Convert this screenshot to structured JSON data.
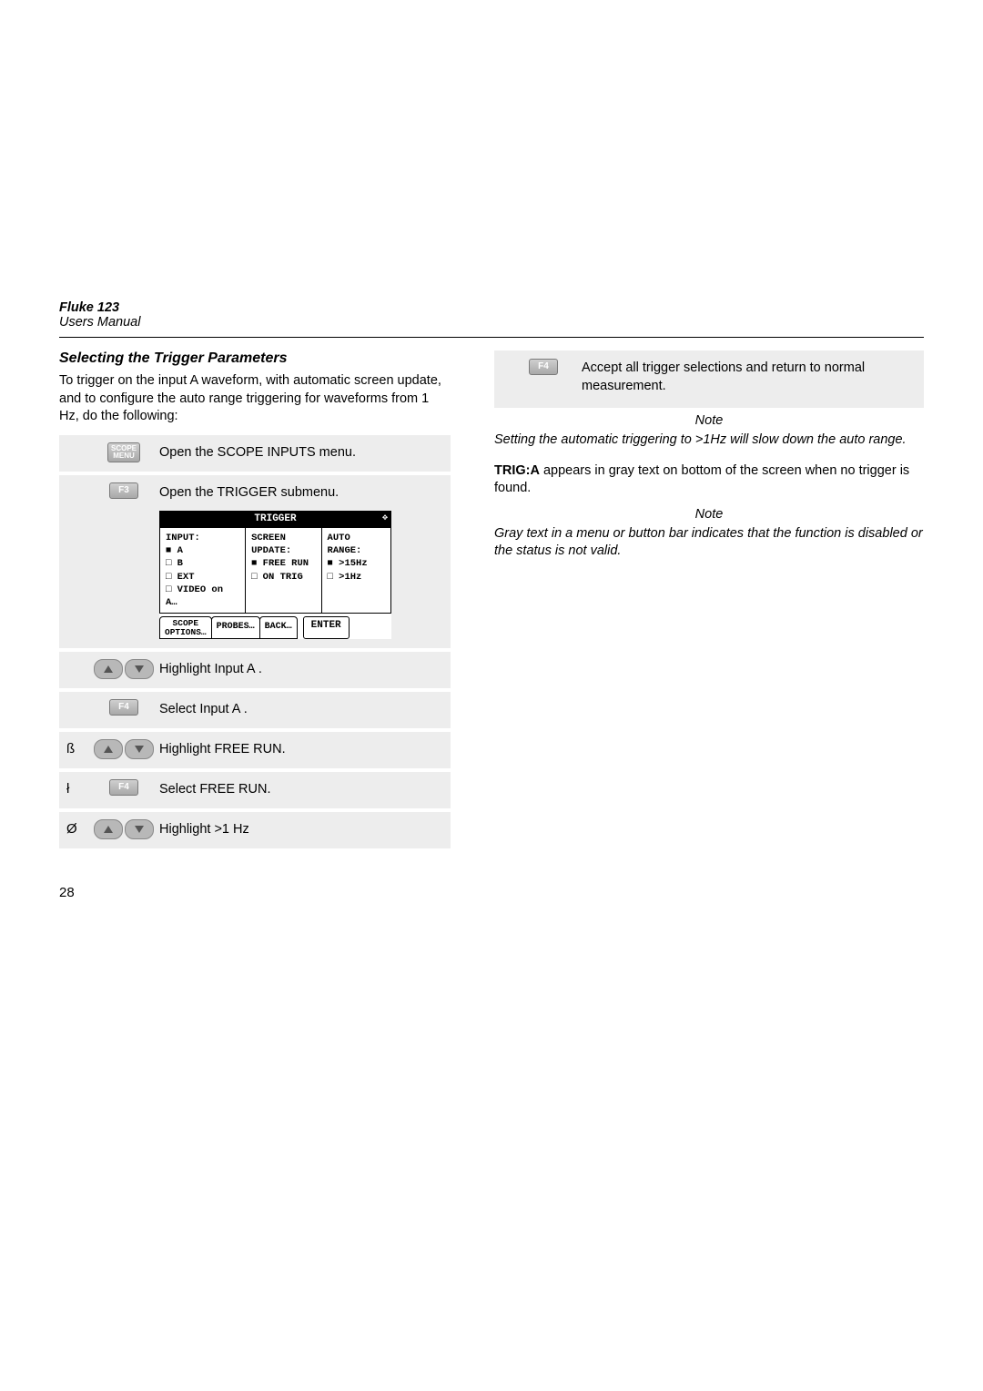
{
  "header": {
    "product": "Fluke 123",
    "manual": "Users Manual"
  },
  "pageNumber": "28",
  "left": {
    "sectionTitle": "Selecting the Trigger Parameters",
    "intro": "To trigger on the input A waveform, with automatic screen update, and to configure the auto range triggering for waveforms from 1 Hz, do the following:",
    "steps": [
      {
        "num": "",
        "keyType": "scope-menu",
        "keyLabelTop": "SCOPE",
        "keyLabelBot": "MENU",
        "text": "Open the SCOPE INPUTS menu."
      },
      {
        "num": "",
        "keyType": "f-key",
        "keyLabel": "F3",
        "text": "Open the TRIGGER submenu."
      },
      {
        "num": "",
        "keyType": "arrows",
        "text": "Highlight Input  A ."
      },
      {
        "num": "",
        "keyType": "f-key",
        "keyLabel": "F4",
        "text": "Select Input  A ."
      },
      {
        "num": "ß",
        "keyType": "arrows",
        "text": "Highlight FREE RUN."
      },
      {
        "num": "ł",
        "keyType": "f-key",
        "keyLabel": "F4",
        "text": "Select FREE RUN."
      },
      {
        "num": "Ø",
        "keyType": "arrows",
        "text": "Highlight >1 Hz"
      }
    ],
    "triggerMenu": {
      "title": "TRIGGER",
      "col1": {
        "head": "INPUT:",
        "items": [
          "A",
          "B",
          "EXT",
          "VIDEO on A…"
        ]
      },
      "col2": {
        "head1": "SCREEN",
        "head2": "UPDATE:",
        "items": [
          "FREE RUN",
          "ON TRIG"
        ]
      },
      "col3": {
        "head1": "AUTO",
        "head2": "RANGE:",
        "items": [
          ">15Hz",
          ">1Hz"
        ]
      },
      "buttons": {
        "b1top": "SCOPE",
        "b1bot": "OPTIONS…",
        "b2": "PROBES…",
        "b3": "BACK…",
        "enter": "ENTER"
      }
    }
  },
  "right": {
    "finalStep": {
      "keyLabel": "F4",
      "text": "Accept all trigger selections and return to normal measurement."
    },
    "note1Head": "Note",
    "note1Body": "Setting the automatic triggering to >1Hz will slow down the auto range.",
    "trigaLabel": "TRIG:A",
    "trigaText": " appears in gray text on bottom of the screen when no trigger is found.",
    "note2Head": "Note",
    "note2Body": "Gray text in a menu or button bar indicates that the function is disabled or the status is not valid."
  }
}
